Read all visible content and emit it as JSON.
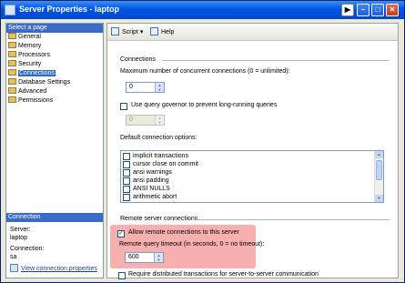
{
  "window": {
    "title": "Server Properties - laptop"
  },
  "select_page": {
    "header": "Select a page",
    "items": [
      {
        "label": "General"
      },
      {
        "label": "Memory"
      },
      {
        "label": "Processors"
      },
      {
        "label": "Security"
      },
      {
        "label": "Connections",
        "selected": true
      },
      {
        "label": "Database Settings"
      },
      {
        "label": "Advanced"
      },
      {
        "label": "Permissions"
      }
    ]
  },
  "connection": {
    "header": "Connection",
    "server_label": "Server:",
    "server_value": "laptop",
    "connection_label": "Connection:",
    "connection_value": "sa",
    "view_link": "View connection properties"
  },
  "toolbar": {
    "script_label": "Script",
    "help_label": "Help"
  },
  "connections_section": {
    "title": "Connections",
    "max_connections_label": "Maximum number of concurrent connections (0 = unlimited):",
    "max_connections_value": "0",
    "query_governor_label": "Use query governor to prevent long-running queries",
    "query_governor_checked": false,
    "query_governor_value": "0",
    "default_options_label": "Default connection options:",
    "options": [
      {
        "label": "implicit transactions",
        "checked": false
      },
      {
        "label": "cursor close on commit",
        "checked": false
      },
      {
        "label": "ansi warnings",
        "checked": false
      },
      {
        "label": "ansi padding",
        "checked": false
      },
      {
        "label": "ANSI NULLS",
        "checked": false
      },
      {
        "label": "arithmetic abort",
        "checked": false
      }
    ]
  },
  "remote_section": {
    "title": "Remote server connections",
    "allow_remote_label": "Allow remote connections to this server",
    "allow_remote_checked": true,
    "timeout_label": "Remote query timeout (in seconds, 0 = no timeout):",
    "timeout_value": "600",
    "distributed_label": "Require distributed transactions for server-to-server communication",
    "distributed_checked": false
  },
  "colors": {
    "title_bar": "#0054e3",
    "highlight": "#f07070",
    "selected": "#316ac5"
  }
}
